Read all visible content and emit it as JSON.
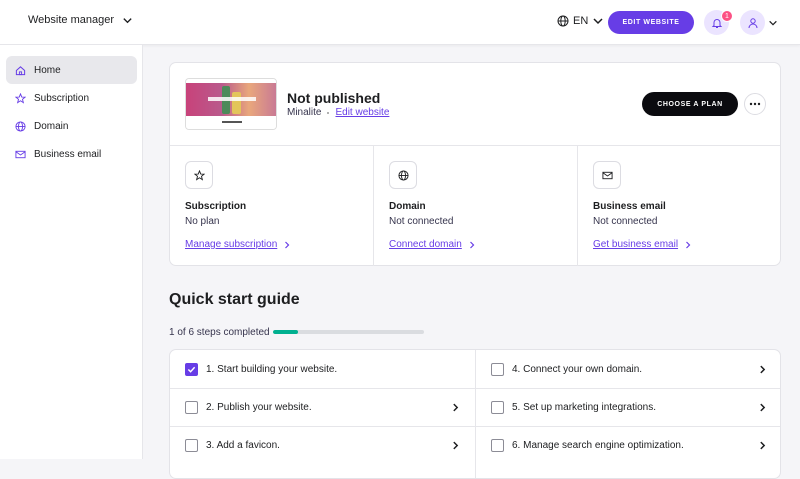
{
  "header": {
    "site_switcher": "Website manager",
    "language": "EN",
    "edit_button": "EDIT WEBSITE",
    "notification_count": "1"
  },
  "sidebar": {
    "items": [
      {
        "label": "Home",
        "icon": "home-icon",
        "active": true
      },
      {
        "label": "Subscription",
        "icon": "star-icon",
        "active": false
      },
      {
        "label": "Domain",
        "icon": "globe-icon",
        "active": false
      },
      {
        "label": "Business email",
        "icon": "mail-icon",
        "active": false
      }
    ]
  },
  "website": {
    "status": "Not published",
    "name": "Minalite",
    "edit_link": "Edit website",
    "plan_button": "CHOOSE A PLAN"
  },
  "summary": [
    {
      "title": "Subscription",
      "value": "No plan",
      "link": "Manage subscription",
      "icon": "star-icon"
    },
    {
      "title": "Domain",
      "value": "Not connected",
      "link": "Connect domain",
      "icon": "globe-icon"
    },
    {
      "title": "Business email",
      "value": "Not connected",
      "link": "Get business email",
      "icon": "mail-icon"
    }
  ],
  "quick_start": {
    "title": "Quick start guide",
    "progress_text": "1 of 6 steps completed",
    "progress_fraction": 0.1667,
    "steps": [
      {
        "label": "1. Start building your website.",
        "done": true
      },
      {
        "label": "2. Publish your website.",
        "done": false
      },
      {
        "label": "3. Add a favicon.",
        "done": false
      },
      {
        "label": "4. Connect your own domain.",
        "done": false
      },
      {
        "label": "5. Set up marketing integrations.",
        "done": false
      },
      {
        "label": "6. Manage search engine optimization.",
        "done": false
      }
    ]
  },
  "colors": {
    "accent": "#673de6",
    "progress": "#00b090",
    "badge": "#fc5185"
  }
}
